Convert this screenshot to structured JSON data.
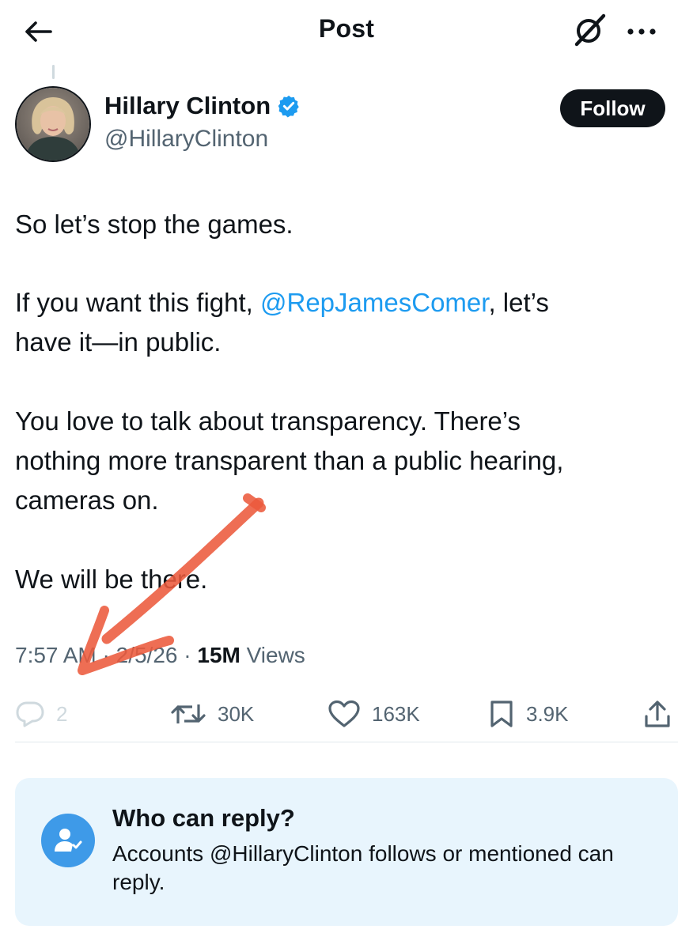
{
  "header": {
    "title": "Post",
    "icons": {
      "back": "arrow-left-icon",
      "grok": "grok-icon",
      "more": "more-horizontal-icon"
    }
  },
  "author": {
    "name": "Hillary Clinton",
    "handle": "@HillaryClinton",
    "verified": true,
    "follow_label": "Follow"
  },
  "post": {
    "line1": "So let’s stop the games.",
    "line2_pre": "If you want this fight, ",
    "mention": "@RepJamesComer",
    "line2_post": ", let’s",
    "line3": "have it—in public.",
    "line4": "You love to talk about transparency. There’s",
    "line5": "nothing more transparent than a public hearing,",
    "line6": "cameras on.",
    "line7": "We will be there."
  },
  "meta": {
    "time": "7:57 AM",
    "sep1": " · ",
    "date": "2/5/26",
    "sep2": " · ",
    "views_count": "15M",
    "views_label": " Views"
  },
  "actions": {
    "replies": "2",
    "reposts": "30K",
    "likes": "163K",
    "bookmarks": "3.9K"
  },
  "reply_settings": {
    "title": "Who can reply?",
    "description": "Accounts @HillaryClinton follows or mentioned can reply."
  },
  "colors": {
    "accent": "#1d9bf0",
    "annotation_arrow": "#ec5a3c",
    "reply_card_bg": "#e8f5fd"
  }
}
